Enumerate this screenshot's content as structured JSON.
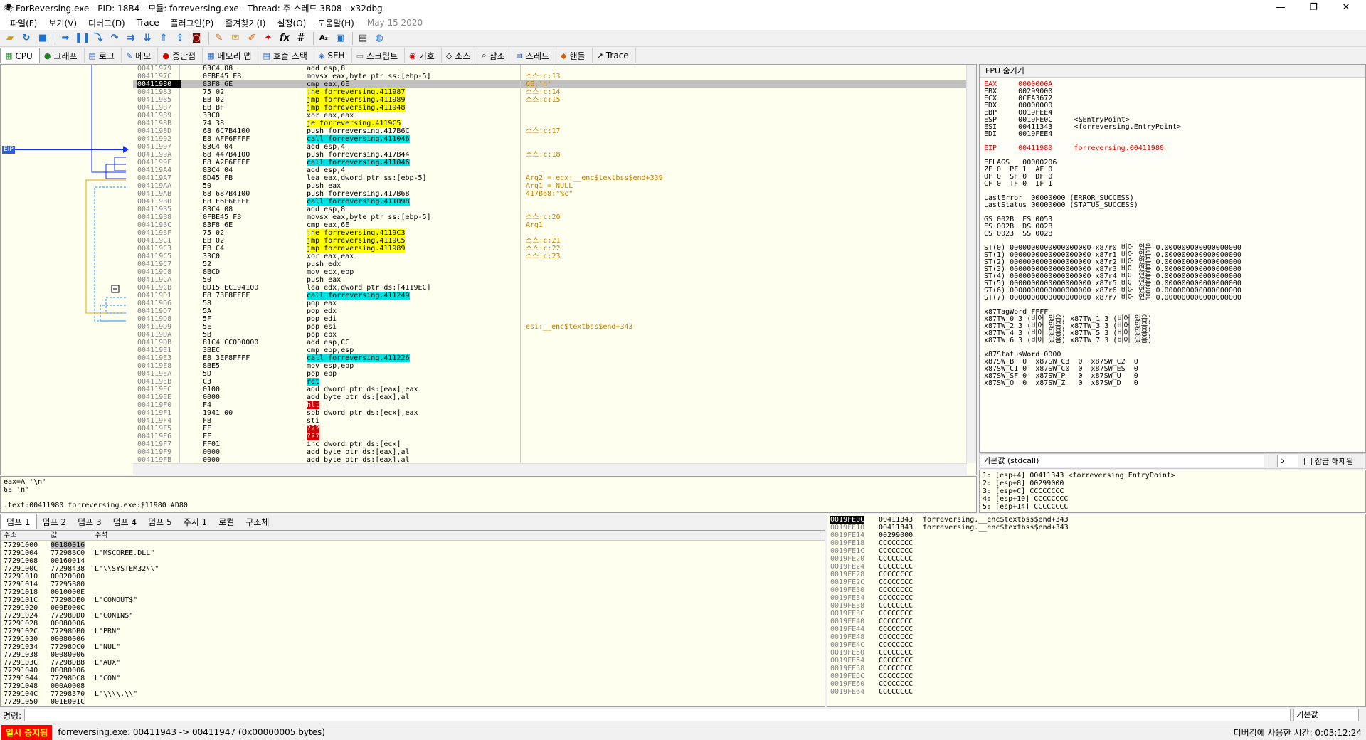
{
  "window": {
    "title": "ForReversing.exe - PID: 18B4 - 모듈: forreversing.exe - Thread: 주 스레드 3B08 - x32dbg"
  },
  "menu": {
    "items": [
      "파일(F)",
      "보기(V)",
      "디버그(D)",
      "Trace",
      "플러그인(P)",
      "즐겨찾기(I)",
      "설정(O)",
      "도움말(H)"
    ],
    "date": "May 15 2020"
  },
  "tabs": [
    "CPU",
    "그래프",
    "로그",
    "메모",
    "중단점",
    "메모리 맵",
    "호출 스택",
    "SEH",
    "스크립트",
    "기호",
    "소스",
    "참조",
    "스레드",
    "핸들",
    "Trace"
  ],
  "eip_label": "EIP",
  "disasm": [
    [
      "00411979",
      "83C4 08",
      "add esp,8",
      ""
    ],
    [
      "0041197C",
      "0FBE45 FB",
      "movsx eax,byte ptr ss:[ebp-5]",
      "소스:c:13"
    ],
    [
      "00411980",
      "83F8 6E",
      "cmp eax,6E",
      "6E:'n'"
    ],
    [
      "00411983",
      "75 02",
      "jne forreversing.411987",
      "소스:c:14"
    ],
    [
      "00411985",
      "EB 02",
      "jmp forreversing.411989",
      "소스:c:15"
    ],
    [
      "00411987",
      "EB BF",
      "jmp forreversing.411948",
      ""
    ],
    [
      "00411989",
      "33C0",
      "xor eax,eax",
      ""
    ],
    [
      "0041198B",
      "74 38",
      "je forreversing.4119C5",
      ""
    ],
    [
      "0041198D",
      "68 6C7B4100",
      "push forreversing.417B6C",
      "소스:c:17"
    ],
    [
      "00411992",
      "E8 AFF6FFFF",
      "call forreversing.411046",
      ""
    ],
    [
      "00411997",
      "83C4 04",
      "add esp,4",
      ""
    ],
    [
      "0041199A",
      "68 447B4100",
      "push forreversing.417B44",
      "소스:c:18"
    ],
    [
      "0041199F",
      "E8 A2F6FFFF",
      "call forreversing.411046",
      ""
    ],
    [
      "004119A4",
      "83C4 04",
      "add esp,4",
      ""
    ],
    [
      "004119A7",
      "8D45 FB",
      "lea eax,dword ptr ss:[ebp-5]",
      "Arg2 = ecx:__enc$textbss$end+339"
    ],
    [
      "004119AA",
      "50",
      "push eax",
      "Arg1 = NULL"
    ],
    [
      "004119AB",
      "68 687B4100",
      "push forreversing.417B68",
      "417B68:\"%c\""
    ],
    [
      "004119B0",
      "E8 E6F6FFFF",
      "call forreversing.411098",
      ""
    ],
    [
      "004119B5",
      "83C4 08",
      "add esp,8",
      ""
    ],
    [
      "004119B8",
      "0FBE45 FB",
      "movsx eax,byte ptr ss:[ebp-5]",
      "소스:c:20"
    ],
    [
      "004119BC",
      "83F8 6E",
      "cmp eax,6E",
      "Arg1"
    ],
    [
      "004119BF",
      "75 02",
      "jne forreversing.4119C3",
      ""
    ],
    [
      "004119C1",
      "EB 02",
      "jmp forreversing.4119C5",
      "소스:c:21"
    ],
    [
      "004119C3",
      "EB C4",
      "jmp forreversing.411989",
      "소스:c:22"
    ],
    [
      "004119C5",
      "33C0",
      "xor eax,eax",
      "소스:c:23"
    ],
    [
      "004119C7",
      "52",
      "push edx",
      ""
    ],
    [
      "004119C8",
      "8BCD",
      "mov ecx,ebp",
      ""
    ],
    [
      "004119CA",
      "50",
      "push eax",
      ""
    ],
    [
      "004119CB",
      "8D15 EC194100",
      "lea edx,dword ptr ds:[4119EC]",
      ""
    ],
    [
      "004119D1",
      "E8 73F8FFFF",
      "call forreversing.411249",
      ""
    ],
    [
      "004119D6",
      "58",
      "pop eax",
      ""
    ],
    [
      "004119D7",
      "5A",
      "pop edx",
      ""
    ],
    [
      "004119D8",
      "5F",
      "pop edi",
      ""
    ],
    [
      "004119D9",
      "5E",
      "pop esi",
      "esi:__enc$textbss$end+343"
    ],
    [
      "004119DA",
      "5B",
      "pop ebx",
      ""
    ],
    [
      "004119DB",
      "81C4 CC000000",
      "add esp,CC",
      ""
    ],
    [
      "004119E1",
      "3BEC",
      "cmp ebp,esp",
      ""
    ],
    [
      "004119E3",
      "E8 3EF8FFFF",
      "call forreversing.411226",
      ""
    ],
    [
      "004119E8",
      "8BE5",
      "mov esp,ebp",
      ""
    ],
    [
      "004119EA",
      "5D",
      "pop ebp",
      ""
    ],
    [
      "004119EB",
      "C3",
      "ret",
      ""
    ],
    [
      "004119EC",
      "0100",
      "add dword ptr ds:[eax],eax",
      ""
    ],
    [
      "004119EE",
      "0000",
      "add byte ptr ds:[eax],al",
      ""
    ],
    [
      "004119F0",
      "F4",
      "hlt",
      ""
    ],
    [
      "004119F1",
      "1941 00",
      "sbb dword ptr ds:[ecx],eax",
      ""
    ],
    [
      "004119F4",
      "FB",
      "sti",
      ""
    ],
    [
      "004119F5",
      "FF",
      "???",
      ""
    ],
    [
      "004119F6",
      "FF",
      "???",
      ""
    ],
    [
      "004119F7",
      "FF01",
      "inc dword ptr ds:[ecx]",
      ""
    ],
    [
      "004119F9",
      "0000",
      "add byte ptr ds:[eax],al",
      ""
    ],
    [
      "004119FB",
      "0000",
      "add byte ptr ds:[eax],al",
      ""
    ]
  ],
  "info": [
    "eax=A '\\n'",
    "6E 'n'",
    "",
    ".text:00411980 forreversing.exe:$11980 #D80"
  ],
  "regs": {
    "header": "FPU 숨기기",
    "lines": [
      "EAX     0000000A",
      "EBX     00299000",
      "ECX     0CFA3672",
      "EDX     00000000",
      "EBP     0019FEE4",
      "ESP     0019FE0C     <&EntryPoint>",
      "ESI     00411343     <forreversing.EntryPoint>",
      "EDI     0019FEE4",
      "",
      "EIP     00411980     forreversing.00411980",
      "",
      "EFLAGS   00000206",
      "ZF 0  PF 1  AF 0",
      "OF 0  SF 0  DF 0",
      "CF 0  TF 0  IF 1",
      "",
      "LastError  00000000 (ERROR_SUCCESS)",
      "LastStatus 00000000 (STATUS_SUCCESS)",
      "",
      "GS 002B  FS 0053",
      "ES 002B  DS 002B",
      "CS 0023  SS 002B",
      "",
      "ST(0) 0000000000000000000 x87r0 비어 있음 0.000000000000000000",
      "ST(1) 0000000000000000000 x87r1 비어 있음 0.000000000000000000",
      "ST(2) 0000000000000000000 x87r2 비어 있음 0.000000000000000000",
      "ST(3) 0000000000000000000 x87r3 비어 있음 0.000000000000000000",
      "ST(4) 0000000000000000000 x87r4 비어 있음 0.000000000000000000",
      "ST(5) 0000000000000000000 x87r5 비어 있음 0.000000000000000000",
      "ST(6) 0000000000000000000 x87r6 비어 있음 0.000000000000000000",
      "ST(7) 0000000000000000000 x87r7 비어 있음 0.000000000000000000",
      "",
      "x87TagWord FFFF",
      "x87TW_0 3 (비어 있음) x87TW_1 3 (비어 있음)",
      "x87TW_2 3 (비어 있음) x87TW_3 3 (비어 있음)",
      "x87TW_4 3 (비어 있음) x87TW_5 3 (비어 있음)",
      "x87TW_6 3 (비어 있음) x87TW_7 3 (비어 있음)",
      "",
      "x87StatusWord 0000",
      "x87SW_B  0  x87SW_C3  0  x87SW_C2  0",
      "x87SW_C1 0  x87SW_C0  0  x87SW_ES  0",
      "x87SW_SF 0  x87SW_P   0  x87SW_U   0",
      "x87SW_O  0  x87SW_Z   0  x87SW_D   0"
    ]
  },
  "callconv": {
    "value": "기본값 (stdcall)",
    "count": "5",
    "lock_label": "잠금 해제됨"
  },
  "stackargs": [
    "1: [esp+4] 00411343 <forreversing.EntryPoint>",
    "2: [esp+8] 00299000",
    "3: [esp+C] CCCCCCCC",
    "4: [esp+10] CCCCCCCC",
    "5: [esp+14] CCCCCCCC"
  ],
  "dumptabs": [
    "덤프 1",
    "덤프 2",
    "덤프 3",
    "덤프 4",
    "덤프 5",
    "주시 1",
    "로컬",
    "구조체"
  ],
  "dump_headers": [
    "주소",
    "값",
    "주석"
  ],
  "dump": [
    [
      "77291000",
      "00180016",
      ""
    ],
    [
      "77291004",
      "77298BC0",
      "L\"MSCOREE.DLL\""
    ],
    [
      "77291008",
      "00160014",
      ""
    ],
    [
      "7729100C",
      "77298438",
      "L\"\\\\SYSTEM32\\\\\""
    ],
    [
      "77291010",
      "00020000",
      ""
    ],
    [
      "77291014",
      "77295B80",
      ""
    ],
    [
      "77291018",
      "0010000E",
      ""
    ],
    [
      "7729101C",
      "77298DE0",
      "L\"CONOUT$\""
    ],
    [
      "77291020",
      "000E000C",
      ""
    ],
    [
      "77291024",
      "77298DD0",
      "L\"CONIN$\""
    ],
    [
      "77291028",
      "00080006",
      ""
    ],
    [
      "7729102C",
      "77298DB0",
      "L\"PRN\""
    ],
    [
      "77291030",
      "00080006",
      ""
    ],
    [
      "77291034",
      "77298DC0",
      "L\"NUL\""
    ],
    [
      "77291038",
      "00080006",
      ""
    ],
    [
      "7729103C",
      "77298DB8",
      "L\"AUX\""
    ],
    [
      "77291040",
      "00080006",
      ""
    ],
    [
      "77291044",
      "77298DC8",
      "L\"CON\""
    ],
    [
      "77291048",
      "000A0008",
      ""
    ],
    [
      "7729104C",
      "77298370",
      "L\"\\\\\\\\.\\\\\""
    ],
    [
      "77291050",
      "001E001C",
      ""
    ]
  ],
  "stack": [
    [
      "0019FE0C",
      "00411343",
      "forreversing.__enc$textbss$end+343"
    ],
    [
      "0019FE10",
      "00411343",
      "forreversing.__enc$textbss$end+343"
    ],
    [
      "0019FE14",
      "00299000",
      ""
    ],
    [
      "0019FE18",
      "CCCCCCCC",
      ""
    ],
    [
      "0019FE1C",
      "CCCCCCCC",
      ""
    ],
    [
      "0019FE20",
      "CCCCCCCC",
      ""
    ],
    [
      "0019FE24",
      "CCCCCCCC",
      ""
    ],
    [
      "0019FE28",
      "CCCCCCCC",
      ""
    ],
    [
      "0019FE2C",
      "CCCCCCCC",
      ""
    ],
    [
      "0019FE30",
      "CCCCCCCC",
      ""
    ],
    [
      "0019FE34",
      "CCCCCCCC",
      ""
    ],
    [
      "0019FE38",
      "CCCCCCCC",
      ""
    ],
    [
      "0019FE3C",
      "CCCCCCCC",
      ""
    ],
    [
      "0019FE40",
      "CCCCCCCC",
      ""
    ],
    [
      "0019FE44",
      "CCCCCCCC",
      ""
    ],
    [
      "0019FE48",
      "CCCCCCCC",
      ""
    ],
    [
      "0019FE4C",
      "CCCCCCCC",
      ""
    ],
    [
      "0019FE50",
      "CCCCCCCC",
      ""
    ],
    [
      "0019FE54",
      "CCCCCCCC",
      ""
    ],
    [
      "0019FE58",
      "CCCCCCCC",
      ""
    ],
    [
      "0019FE5C",
      "CCCCCCCC",
      ""
    ],
    [
      "0019FE60",
      "CCCCCCCC",
      ""
    ],
    [
      "0019FE64",
      "CCCCCCCC",
      ""
    ]
  ],
  "cmd": {
    "label": "명령:",
    "mode": "기본값"
  },
  "status": {
    "state": "일시 중지됨",
    "message": "forreversing.exe: 00411943 -> 00411947 (0x00000005 bytes)",
    "time": "디버깅에 사용한 시간: 0:03:12:24"
  }
}
